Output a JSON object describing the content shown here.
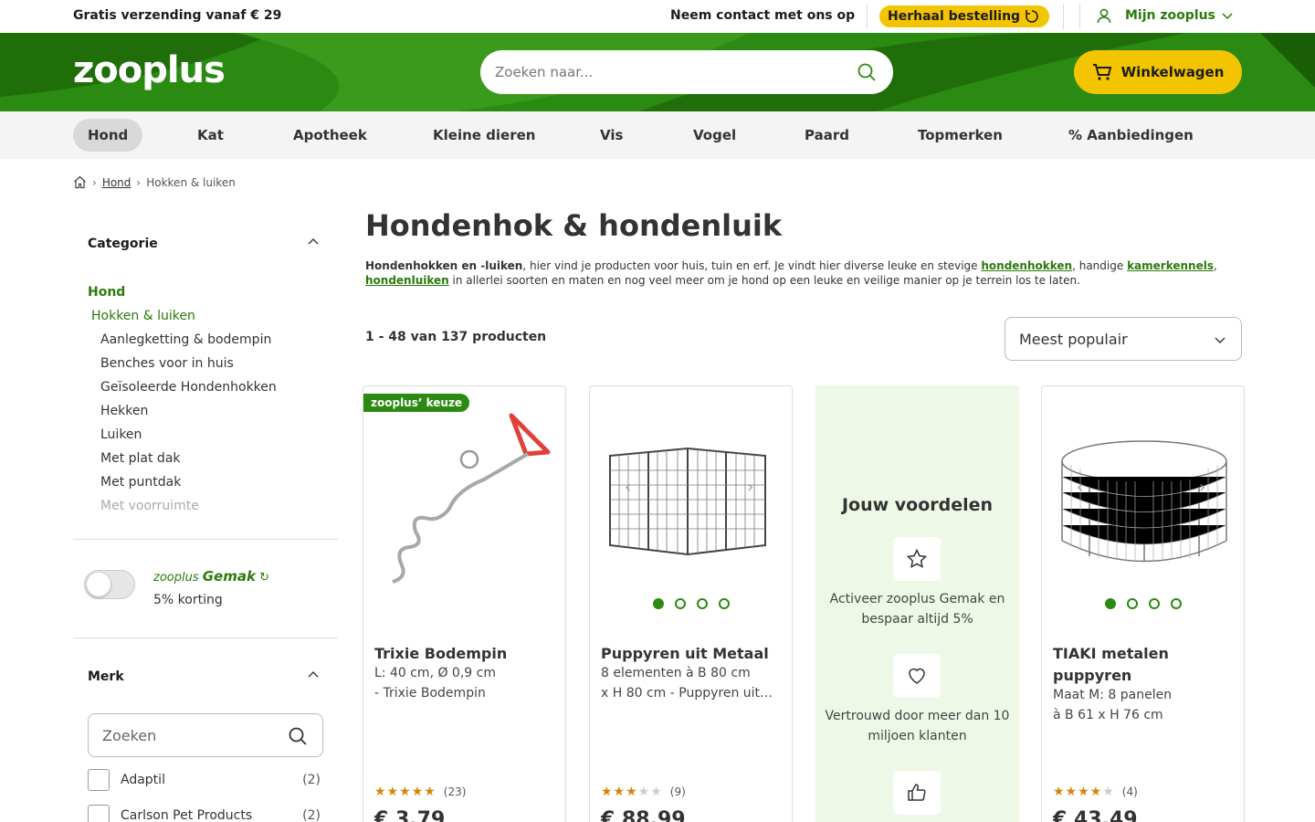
{
  "topbar": {
    "shipping": "Gratis verzending vanaf € 29",
    "contact": "Neem contact met ons op",
    "reorder": "Herhaal bestelling",
    "account": "Mijn zooplus"
  },
  "header": {
    "logo": "zooplus",
    "search_placeholder": "Zoeken naar...",
    "cart": "Winkelwagen"
  },
  "nav": [
    "Hond",
    "Kat",
    "Apotheek",
    "Kleine dieren",
    "Vis",
    "Vogel",
    "Paard",
    "Topmerken",
    "% Aanbiedingen"
  ],
  "breadcrumb": {
    "level1": "Hond",
    "level2": "Hokken & luiken"
  },
  "sidebar": {
    "category_title": "Categorie",
    "root": "Hond",
    "current": "Hokken & luiken",
    "subcategories": [
      "Aanlegketting & bodempin",
      "Benches voor in huis",
      "Geïsoleerde Hondenhokken",
      "Hekken",
      "Luiken",
      "Met plat dak",
      "Met puntdak",
      "Met voorruimte"
    ],
    "gemak_brand": "zooplus",
    "gemak_name": "Gemak",
    "gemak_text": "5% korting",
    "brand_title": "Merk",
    "brand_search_placeholder": "Zoeken",
    "brands": [
      {
        "name": "Adaptil",
        "count": "(2)"
      },
      {
        "name": "Carlson Pet Products",
        "count": "(2)"
      }
    ]
  },
  "main": {
    "title": "Hondenhok & hondenluik",
    "intro_bold": "Hondenhokken en -luiken",
    "intro_1": ", hier vind je producten voor huis, tuin en erf. Je vindt hier diverse leuke en stevige ",
    "link_1": "hondenhokken",
    "intro_2": ", handige ",
    "link_2": "kamerkennels",
    "intro_3": ", ",
    "link_3": "hondenluiken",
    "intro_4": " in allerlei soorten en maten en nog veel meer om je hond op een leuke en veilige manier op je terrein los te laten.",
    "count": "1 - 48 van 137 producten",
    "sort": "Meest populair"
  },
  "products": [
    {
      "badge": "zooplus’ keuze",
      "name": "Trixie Bodempin",
      "desc1": "L: 40 cm, Ø 0,9 cm",
      "desc2": "- Trixie Bodempin",
      "reviews": "(23)",
      "rating": 5,
      "price": "€ 3,79"
    },
    {
      "name": "Puppyren uit Metaal",
      "desc1": "8 elementen à B 80 cm",
      "desc2": "x H 80 cm - Puppyren uit…",
      "reviews": "(9)",
      "rating": 3,
      "price": "€ 88,99"
    },
    {
      "name": "TIAKI metalen puppyren",
      "desc1": "Maat M: 8 panelen",
      "desc2": "à B 61 x H 76 cm",
      "reviews": "(4)",
      "rating": 4,
      "price": "€ 43,49"
    }
  ],
  "promo": {
    "title": "Jouw voordelen",
    "benefit1": "Activeer zooplus Gemak en bespaar altijd 5%",
    "benefit2": "Vertrouwd door meer dan 10 miljoen klanten"
  },
  "colors": {
    "brand_green": "#2b8a12",
    "accent_yellow": "#f3c400",
    "link_green": "#2b7a0b"
  }
}
